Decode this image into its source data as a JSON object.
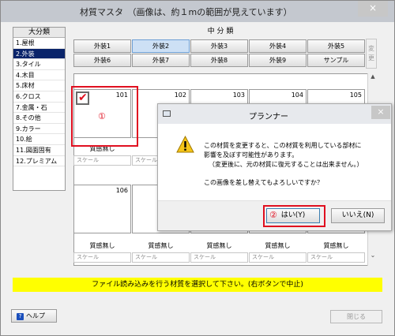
{
  "window": {
    "title": "材質マスタ　（画像は、約１mの範囲が見えています）",
    "close_glyph": "×"
  },
  "category_panel": {
    "header": "大分類",
    "items": [
      {
        "label": "1.屋根"
      },
      {
        "label": "2.外装",
        "selected": true
      },
      {
        "label": "3.タイル"
      },
      {
        "label": "4.木目"
      },
      {
        "label": "5.床材"
      },
      {
        "label": "6.クロス"
      },
      {
        "label": "7.金属・石"
      },
      {
        "label": "8.その他"
      },
      {
        "label": "9.カラー"
      },
      {
        "label": "10.絵"
      },
      {
        "label": "11.図面固有"
      },
      {
        "label": "12.プレミアム"
      }
    ]
  },
  "subcategory": {
    "header": "中 分 類",
    "buttons": [
      {
        "label": "外装1"
      },
      {
        "label": "外装2",
        "active": true
      },
      {
        "label": "外装3"
      },
      {
        "label": "外装4"
      },
      {
        "label": "外装5"
      },
      {
        "label": "外装6"
      },
      {
        "label": "外装7"
      },
      {
        "label": "外装8"
      },
      {
        "label": "外装9"
      },
      {
        "label": "サンプル"
      }
    ],
    "change_label": "変更"
  },
  "materials": {
    "row1": [
      {
        "number": "101",
        "name": "質感無し",
        "scale": "スケール",
        "checked": true
      },
      {
        "number": "102",
        "name": "",
        "scale": "スケール"
      },
      {
        "number": "103",
        "name": "",
        "scale": ""
      },
      {
        "number": "104",
        "name": "",
        "scale": ""
      },
      {
        "number": "105",
        "name": "",
        "scale": ""
      }
    ],
    "row2": [
      {
        "number": "106",
        "name": "質感無し",
        "scale": "スケール"
      },
      {
        "number": "",
        "name": "質感無し",
        "scale": "スケール"
      },
      {
        "number": "",
        "name": "質感無し",
        "scale": "スケール"
      },
      {
        "number": "",
        "name": "質感無し",
        "scale": "スケール"
      },
      {
        "number": "",
        "name": "質感無し",
        "scale": "スケール"
      }
    ]
  },
  "scrollbar": {
    "up_glyph": "▲",
    "down_glyph": "⌄"
  },
  "status_message": "ファイル読み込みを行う材質を選択して下さい。(右ボタンで中止)",
  "footer": {
    "help_label": "ヘルプ",
    "help_icon_glyph": "?",
    "close_label": "閉じる"
  },
  "annotations": {
    "marker1": "①",
    "marker2": "②"
  },
  "dialog": {
    "title": "プランナー",
    "close_glyph": "×",
    "message_lines": [
      "この材質を変更すると、この材質を利用している部材に",
      "影響を及ぼす可能性があります。",
      "（変更後に、元の材質に復元することは出来ません。）",
      "この画像を差し替えてもよろしいですか？"
    ],
    "yes_label": "はい(Y)",
    "no_label": "いいえ(N)"
  },
  "colors": {
    "accent_red": "#e01020",
    "selection_blue": "#0a246a",
    "status_yellow": "#ffff00"
  }
}
